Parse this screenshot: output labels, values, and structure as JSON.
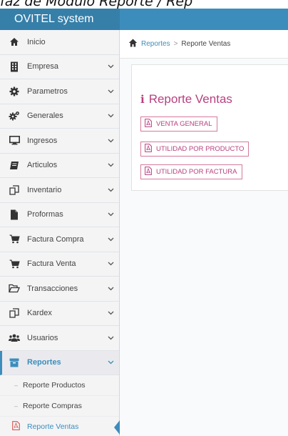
{
  "caption": "faz de Módulo Reporte / Rep",
  "app": {
    "title": "OVITEL system"
  },
  "sidebar": {
    "items": [
      {
        "label": "Inicio",
        "icon": "home-icon",
        "has_chevron": false
      },
      {
        "label": "Empresa",
        "icon": "building-icon",
        "has_chevron": true
      },
      {
        "label": "Parametros",
        "icon": "gear-icon",
        "has_chevron": true
      },
      {
        "label": "Generales",
        "icon": "gears-icon",
        "has_chevron": true
      },
      {
        "label": "Ingresos",
        "icon": "monitor-icon",
        "has_chevron": true
      },
      {
        "label": "Articulos",
        "icon": "book-icon",
        "has_chevron": true
      },
      {
        "label": "Inventario",
        "icon": "copy-icon",
        "has_chevron": true
      },
      {
        "label": "Proformas",
        "icon": "file-icon",
        "has_chevron": true
      },
      {
        "label": "Factura Compra",
        "icon": "cart-icon",
        "has_chevron": true
      },
      {
        "label": "Factura Venta",
        "icon": "cart-icon",
        "has_chevron": true
      },
      {
        "label": "Transacciones",
        "icon": "folder-open-icon",
        "has_chevron": true
      },
      {
        "label": "Kardex",
        "icon": "copy-icon",
        "has_chevron": true
      },
      {
        "label": "Usuarios",
        "icon": "users-icon",
        "has_chevron": true
      },
      {
        "label": "Reportes",
        "icon": "archive-icon",
        "has_chevron": true
      }
    ],
    "subitems": [
      {
        "label": "Reporte Productos"
      },
      {
        "label": "Reporte Compras"
      },
      {
        "label": "Reporte Ventas"
      }
    ]
  },
  "breadcrumb": {
    "parent": "Reportes",
    "separator": ">",
    "current": "Reporte Ventas"
  },
  "panel": {
    "title": "Reporte Ventas",
    "buttons": [
      {
        "label": "VENTA GENERAL",
        "icon": "file-pdf-icon"
      },
      {
        "label": "UTILIDAD POR PRODUCTO",
        "icon": "file-pdf-icon"
      },
      {
        "label": "UTILIDAD POR FACTURA",
        "icon": "file-pdf-icon"
      }
    ]
  },
  "colors": {
    "topbar": "#3c8dbc",
    "brand": "#367fa9",
    "accent": "#b8407f",
    "link": "#3c8dbc"
  }
}
